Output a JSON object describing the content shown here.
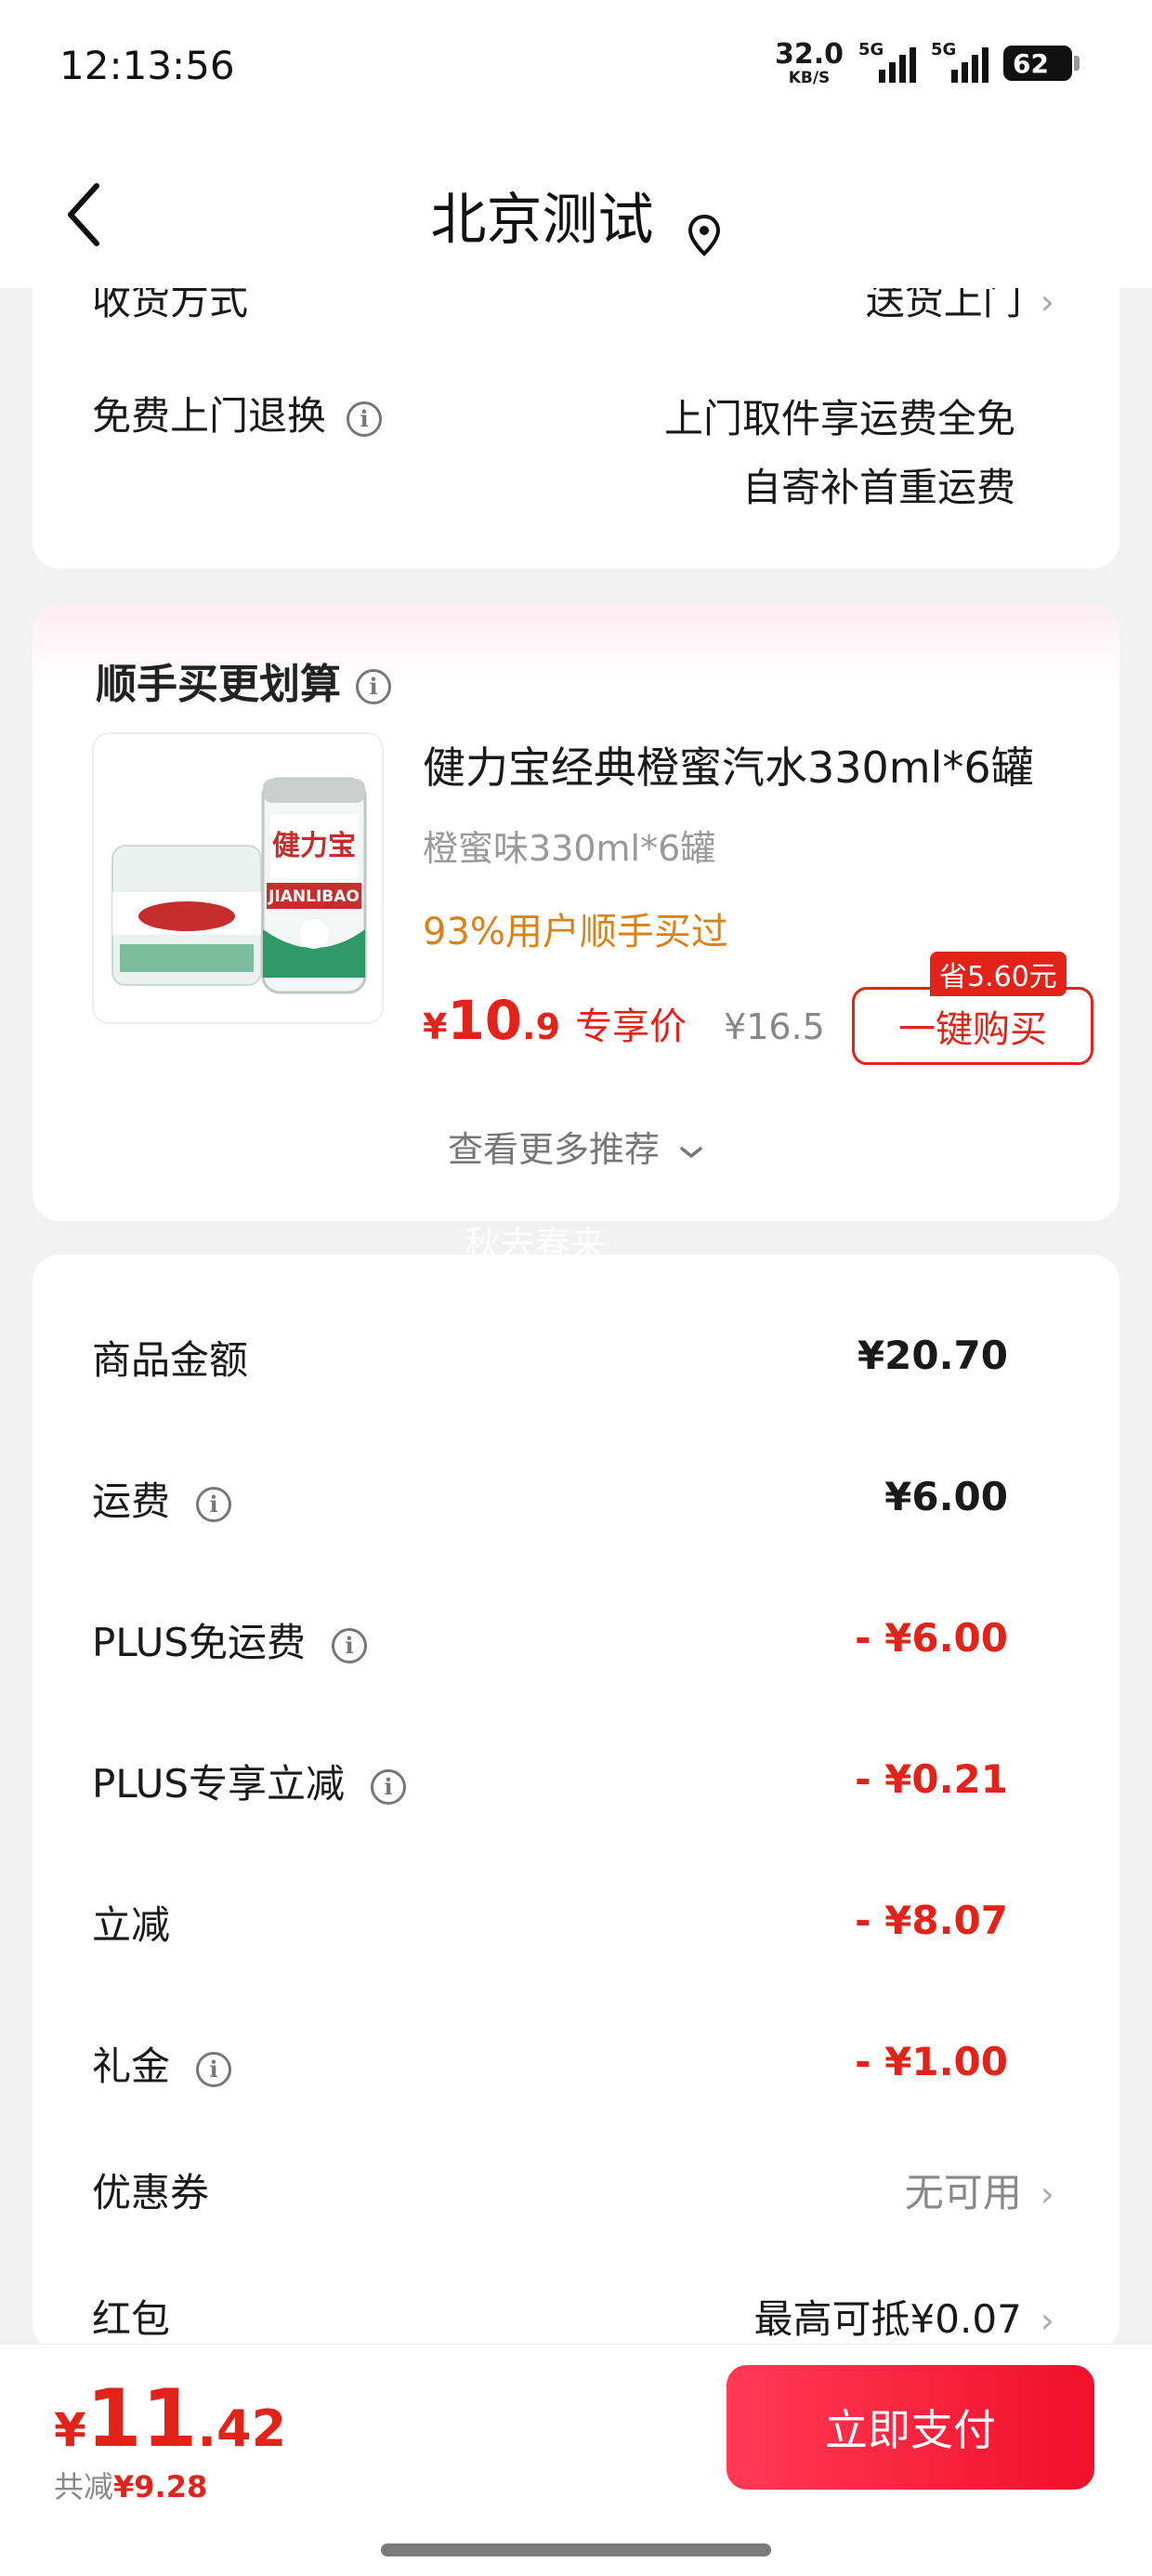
{
  "status_bar": {
    "time": "12:13:56",
    "speed_value": "32.0",
    "speed_unit": "KB/S",
    "network_1": "5G",
    "network_2": "5G",
    "battery": "62"
  },
  "header": {
    "title": "北京测试",
    "back_icon": "chevron-left-icon",
    "location_icon": "location-pin-icon"
  },
  "delivery": {
    "method_label": "收货方式",
    "method_value": "送货上门",
    "return_label": "免费上门退换",
    "return_value_line1": "上门取件享运费全免",
    "return_value_line2": "自寄补首重运费"
  },
  "recommend": {
    "title": "顺手买更划算",
    "product": {
      "name": "健力宝经典橙蜜汽水330ml*6罐",
      "spec": "橙蜜味330ml*6罐",
      "users": "93%用户顺手买过",
      "price_currency": "¥",
      "price_int": "10",
      "price_dec": ".9",
      "price_tag": "专享价",
      "original_price": "¥16.5",
      "save_badge": "省5.60元",
      "buy_label": "一键购买",
      "image_brand_text": "JIANLIBAO"
    },
    "more_label": "查看更多推荐"
  },
  "watermark": "秋去春来",
  "summary": {
    "rows": [
      {
        "label": "商品金额",
        "value": "¥20.70"
      },
      {
        "label": "运费",
        "value": "¥6.00"
      },
      {
        "label": "PLUS免运费",
        "value": "- ¥6.00"
      },
      {
        "label": "PLUS专享立减",
        "value": "- ¥0.21"
      },
      {
        "label": "立减",
        "value": "- ¥8.07"
      },
      {
        "label": "礼金",
        "value": "- ¥1.00"
      },
      {
        "label": "优惠券",
        "value": "无可用"
      },
      {
        "label": "红包",
        "value": "最高可抵¥0.07"
      }
    ]
  },
  "bottom": {
    "currency": "¥",
    "total_int": "11",
    "total_dec": ".42",
    "saved_label": "共减",
    "saved_value": "¥9.28",
    "pay_label": "立即支付"
  },
  "colors": {
    "accent_red": "#e2231a",
    "pay_button": "#f41d3a",
    "promo_orange": "#d9821a"
  }
}
